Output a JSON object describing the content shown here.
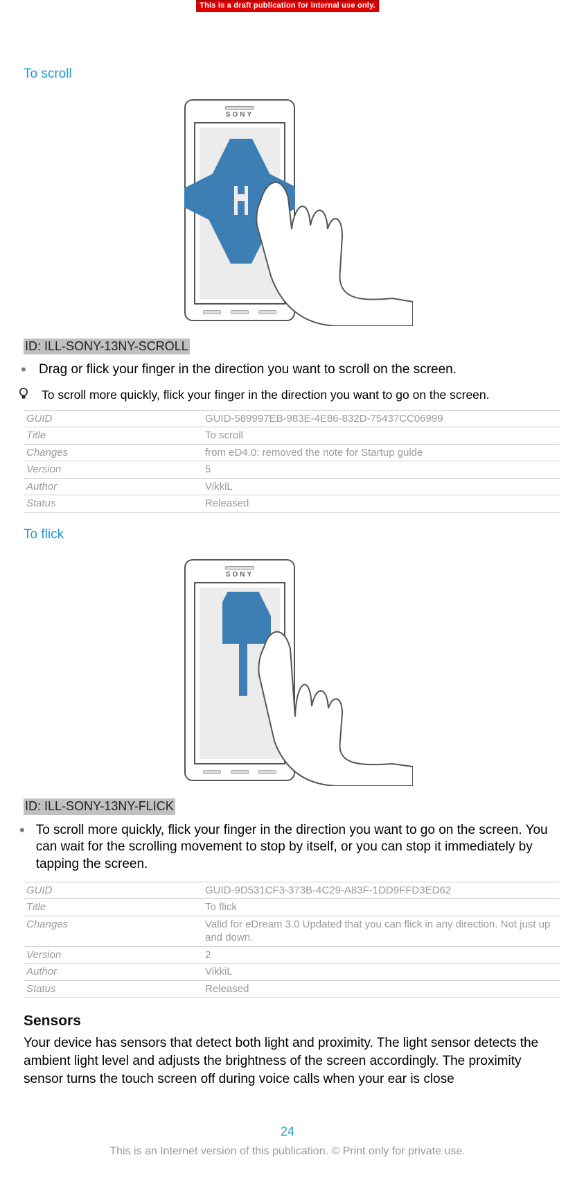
{
  "banner": "This is a draft publication for internal use only.",
  "phone_brand": "SONY",
  "scroll": {
    "heading": "To scroll",
    "image_id": "ID: ILL-SONY-13NY-SCROLL",
    "bullet": "Drag or flick your finger in the direction you want to scroll on the screen.",
    "tip": "To scroll more quickly, flick your finger in the direction you want to go on the screen.",
    "meta": {
      "GUID": "GUID-589997EB-983E-4E86-832D-75437CC06999",
      "Title": "To scroll",
      "Changes": "from eD4.0: removed the note for Startup guide",
      "Version": "5",
      "Author": "VikkiL",
      "Status": "Released"
    }
  },
  "flick": {
    "heading": "To flick",
    "image_id": "ID: ILL-SONY-13NY-FLICK",
    "bullet": "To scroll more quickly, flick your finger in the direction you want to go on the screen. You can wait for the scrolling movement to stop by itself, or you can stop it immediately by tapping the screen.",
    "meta": {
      "GUID": "GUID-9D531CF3-373B-4C29-A83F-1DD9FFD3ED62",
      "Title": "To flick",
      "Changes": "Valid for eDream 3.0 Updated that you can flick in any direction. Not just up and down.",
      "Version": "2",
      "Author": "VikkiL",
      "Status": "Released"
    }
  },
  "sensors": {
    "heading": "Sensors",
    "paragraph": "Your device has sensors that detect both light and proximity. The light sensor detects the ambient light level and adjusts the brightness of the screen accordingly. The proximity sensor turns the touch screen off during voice calls when your ear is close"
  },
  "page_number": "24",
  "footer": "This is an Internet version of this publication. © Print only for private use."
}
